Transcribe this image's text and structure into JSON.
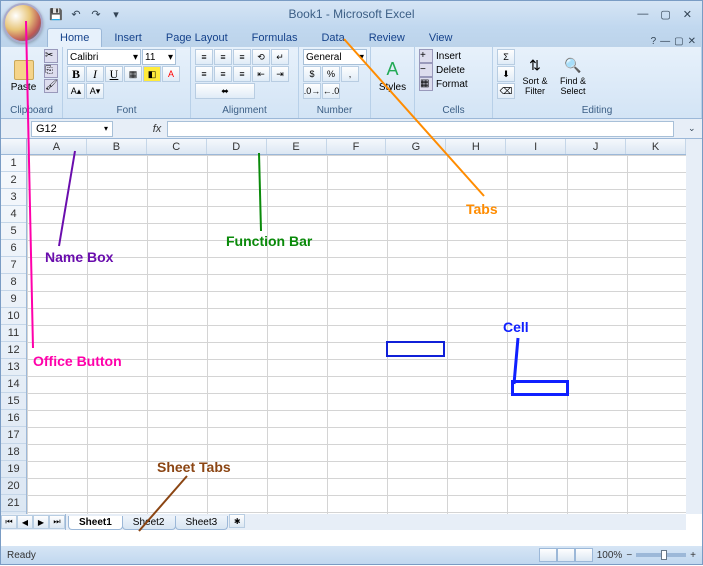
{
  "title": "Book1 - Microsoft Excel",
  "tabs": [
    "Home",
    "Insert",
    "Page Layout",
    "Formulas",
    "Data",
    "Review",
    "View"
  ],
  "active_tab": 0,
  "ribbon": {
    "clipboard": {
      "label": "Clipboard",
      "paste": "Paste"
    },
    "font": {
      "label": "Font",
      "name": "Calibri",
      "size": "11"
    },
    "alignment": {
      "label": "Alignment"
    },
    "number": {
      "label": "Number",
      "format": "General"
    },
    "styles": {
      "label": "Styles"
    },
    "cells": {
      "label": "Cells",
      "insert": "Insert",
      "delete": "Delete",
      "format": "Format"
    },
    "editing": {
      "label": "Editing",
      "sort": "Sort & Filter",
      "find": "Find & Select"
    }
  },
  "name_box": "G12",
  "fx": "fx",
  "columns": [
    "A",
    "B",
    "C",
    "D",
    "E",
    "F",
    "G",
    "H",
    "I",
    "J",
    "K"
  ],
  "rows": [
    1,
    2,
    3,
    4,
    5,
    6,
    7,
    8,
    9,
    10,
    11,
    12,
    13,
    14,
    15,
    16,
    17,
    18,
    19,
    20,
    21
  ],
  "sheets": [
    "Sheet1",
    "Sheet2",
    "Sheet3"
  ],
  "active_sheet": 0,
  "status": "Ready",
  "zoom": "100%",
  "selected_cell": {
    "col": 6,
    "row": 11
  },
  "annotations": {
    "office_button": "Office Button",
    "name_box": "Name Box",
    "function_bar": "Function Bar",
    "tabs": "Tabs",
    "cell": "Cell",
    "sheet_tabs": "Sheet Tabs"
  }
}
